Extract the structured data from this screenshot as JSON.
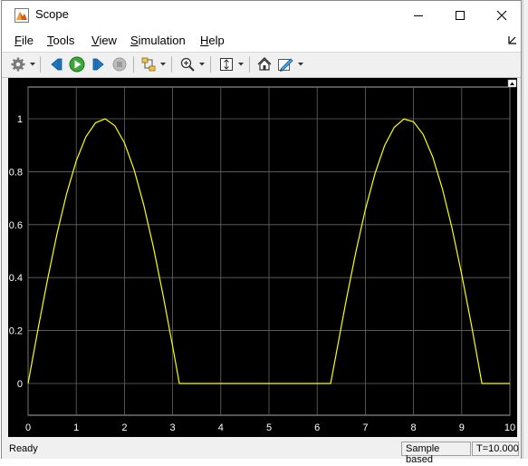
{
  "window": {
    "title": "Scope"
  },
  "menu": {
    "items": [
      {
        "label": "File",
        "underline": "F",
        "rest": "ile"
      },
      {
        "label": "Tools",
        "underline": "T",
        "rest": "ools"
      },
      {
        "label": "View",
        "underline": "V",
        "rest": "iew"
      },
      {
        "label": "Simulation",
        "underline": "S",
        "rest": "imulation"
      },
      {
        "label": "Help",
        "underline": "H",
        "rest": "elp"
      }
    ]
  },
  "toolbar": {
    "icons": [
      "gear-icon",
      "step-back-icon",
      "run-icon",
      "step-forward-icon",
      "stop-icon",
      "signal-selector-icon",
      "zoom-in-icon",
      "autoscale-icon",
      "highlight-icon",
      "style-icon"
    ]
  },
  "status": {
    "left": "Ready",
    "mode": "Sample based",
    "time": "T=10.000"
  },
  "colors": {
    "trace": "#ffff00",
    "plot_bg": "#000000",
    "grid": "#666666",
    "axis_text": "#ffffff"
  },
  "chart_data": {
    "type": "line",
    "title": "",
    "xlabel": "",
    "ylabel": "",
    "xlim": [
      0,
      10
    ],
    "ylim": [
      -0.12,
      1.12
    ],
    "xticks": [
      0,
      1,
      2,
      3,
      4,
      5,
      6,
      7,
      8,
      9,
      10
    ],
    "yticks": [
      0,
      0.2,
      0.4,
      0.6,
      0.8,
      1
    ],
    "grid": true,
    "series": [
      {
        "x": [
          0,
          0.2,
          0.4,
          0.6,
          0.8,
          1.0,
          1.2,
          1.4,
          1.6,
          1.8,
          2.0,
          2.2,
          2.4,
          2.6,
          2.8,
          3.0,
          3.14,
          3.2,
          4.0,
          5.0,
          6.0,
          6.28,
          6.4,
          6.6,
          6.8,
          7.0,
          7.2,
          7.4,
          7.6,
          7.8,
          8.0,
          8.2,
          8.4,
          8.6,
          8.8,
          9.0,
          9.2,
          9.42,
          9.6,
          10.0
        ],
        "y": [
          0,
          0.199,
          0.389,
          0.565,
          0.717,
          0.841,
          0.932,
          0.985,
          1.0,
          0.974,
          0.909,
          0.808,
          0.675,
          0.516,
          0.335,
          0.141,
          0,
          0,
          0,
          0,
          0,
          0,
          0.117,
          0.312,
          0.494,
          0.657,
          0.793,
          0.899,
          0.968,
          0.999,
          0.989,
          0.941,
          0.855,
          0.735,
          0.586,
          0.412,
          0.223,
          0,
          0,
          0
        ]
      }
    ]
  }
}
